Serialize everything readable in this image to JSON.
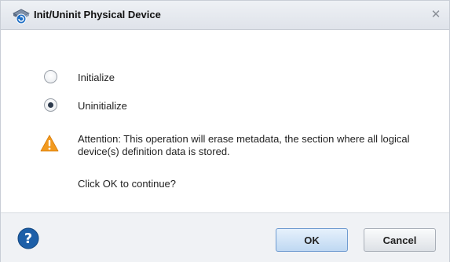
{
  "dialog": {
    "title": "Init/Uninit Physical Device",
    "title_icon": "device-refresh-icon",
    "close_label": "✕"
  },
  "options": [
    {
      "label": "Initialize",
      "selected": false
    },
    {
      "label": "Uninitialize",
      "selected": true
    }
  ],
  "warning": {
    "icon": "warning-icon",
    "text": "Attention: This operation will erase metadata, the section where all logical device(s) definition data is stored."
  },
  "prompt": "Click OK to continue?",
  "footer": {
    "help_icon": "help-icon",
    "ok_label": "OK",
    "cancel_label": "Cancel"
  },
  "colors": {
    "warning": "#f29a1f",
    "help": "#1d5fa8",
    "ok_border": "#6f9bd0"
  }
}
